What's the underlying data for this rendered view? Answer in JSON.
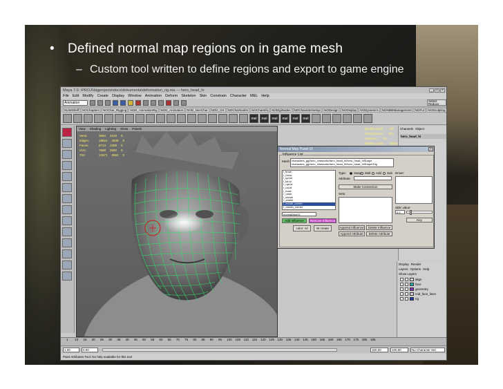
{
  "slide": {
    "bullet1": "Defined normal map regions on in game mesh",
    "bullet2": "Custom tool written to define regions and export to game engine"
  },
  "maya": {
    "title": "Maya 7.0: \\PROJ\\\\bigprojects\\docs\\dokumenta\\deformation_rig.ma  ---  hero_head_hi",
    "menu": [
      "File",
      "Edit",
      "Modify",
      "Create",
      "Display",
      "Window",
      "Animation",
      "Deform",
      "Skeleton",
      "Skin",
      "Constrain",
      "Character",
      "MEL",
      "Help"
    ],
    "mode_combo": "Animation",
    "select_label": "Select Reduce",
    "shelf_tabs": [
      "NUWShelf",
      "NOChapters",
      "NOChar_Rigging",
      "NOD_AnimationRig",
      "NOD_Animation",
      "NOD_NonChar",
      "NOD_GX",
      "NOCharNodes",
      "NOCharInfo",
      "NODigiNodes",
      "NOCharacterSetup",
      "NODesign",
      "NODisplay",
      "NODynamics",
      "NONMEManagement",
      "NOFur",
      "NOSculpting",
      "NOWeldEx",
      "NOConstraints",
      "NOCurveTools",
      "Rich"
    ],
    "shelf_mel": "mel",
    "viewport_menu": [
      "View",
      "Shading",
      "Lighting",
      "Show",
      "Panels"
    ],
    "hud": [
      {
        "k": "Verts:",
        "a": "3694",
        "b": "2419",
        "c": "0"
      },
      {
        "k": "Edges:",
        "a": "18621",
        "b": "4838",
        "c": "0"
      },
      {
        "k": "Faces:",
        "a": "8713",
        "b": "2388",
        "c": "0"
      },
      {
        "k": "UVs:",
        "a": "7808",
        "b": "2592",
        "c": "0"
      },
      {
        "k": "Tris:",
        "a": "12671",
        "b": "2652",
        "c": "0"
      }
    ],
    "hud_right": [
      {
        "k": "BackfaceCull:",
        "v": "Off"
      },
      {
        "k": "Smoothness:",
        "v": "N/A"
      },
      {
        "k": "Instance:",
        "v": "No"
      },
      {
        "k": "Display Layer:",
        "v": "default"
      }
    ],
    "channel_tabs": [
      "Channels",
      "Object"
    ],
    "channel_object": "hero_head_hi",
    "layer_tabs": [
      "Display",
      "Render"
    ],
    "layer_menu": [
      "Layers",
      "Options",
      "Help"
    ],
    "layer_sub": [
      "Show Layers"
    ],
    "layers": [
      {
        "name": "align",
        "color": "#d8d8d8"
      },
      {
        "name": "face",
        "color": "#2ea8a8"
      },
      {
        "name": "geometry",
        "color": "#8a2fb4"
      },
      {
        "name": "mid_face_lines",
        "color": "#cfcfcf"
      },
      {
        "name": "rig",
        "color": "#1f3aa8"
      }
    ],
    "timeline_ticks": [
      "1",
      "10",
      "15",
      "20",
      "25",
      "30",
      "35",
      "40",
      "45",
      "50",
      "55",
      "60",
      "65",
      "70",
      "75",
      "80",
      "85",
      "90",
      "95",
      "100",
      "105",
      "110",
      "115",
      "120",
      "125",
      "130",
      "135",
      "140",
      "145",
      "150",
      "155",
      "160",
      "165",
      "170",
      "175",
      "180",
      "185"
    ],
    "range_start": "1.00",
    "range_start2": "0.00",
    "range_end": "100.00",
    "range_end2": "100.00",
    "char_set": "No Character Set",
    "help_line": "Paint Attributes Tool: No help available for this tool"
  },
  "dialog": {
    "title": "Normal Map Panel UI",
    "group_label": "Influence List",
    "mesh_label": "Mesh",
    "mesh_value": "characters_gg/hero_cinematic/hero_head_hi/hero_head_hiShape",
    "mesh_value2": "characters_gg/hero_cinematic/hero_head_hi/hero_head_hiShapeOrig",
    "influences": [
      "l_brow",
      "r_brow",
      "l_upLid",
      "l_loLid",
      "r_upLid",
      "r_loLid",
      "l_nose",
      "r_nose",
      "l_cheek",
      "r_cheek",
      "l_mouth_corner",
      "r_mouth_corner"
    ],
    "selected_influence": "normalMap[1]",
    "add_influence": "Add Influence",
    "remove_influence": "Remove Influence",
    "color_label": "color: rvl",
    "create_label": "W create",
    "type_label": "Type:",
    "radio_options": [
      "Swap",
      "Mult",
      "Add",
      "Sub"
    ],
    "attribute_label": "Attribute",
    "make_connection": "Make Connection",
    "sets_label": "Sets:",
    "append_influence": "Append Influence",
    "delete_influence": "Delete Influence",
    "append_attribute": "Append Attribute",
    "delete_attribute": "Delete Attribute",
    "driver_label": "Driver:",
    "sdk_label": "SDK value:",
    "sdk_value": "0.0",
    "key_label": "Key"
  }
}
